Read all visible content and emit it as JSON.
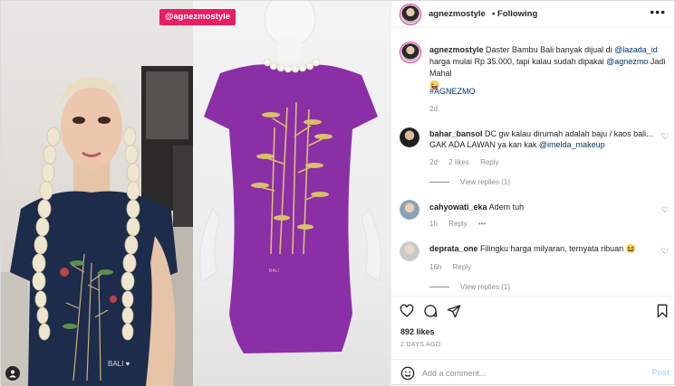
{
  "media": {
    "handle_tag": "@agnezmostyle"
  },
  "header": {
    "username": "agnezmostyle",
    "follow_status": "• Following",
    "more_icon": "more-horizontal-icon"
  },
  "caption": {
    "username": "agnezmostyle",
    "text_1": "Daster Bambu Bali banyak dijual di",
    "mention_1": "@lazada_id",
    "text_2": "harga mulai Rp 35.000, tapi kalau sudah dipakai",
    "mention_2": "@agnezmo",
    "text_3": "Jadi Mahal",
    "emoji": "😜",
    "hashtag": "#AGNEZMO",
    "time": "2d"
  },
  "comments": [
    {
      "username": "bahar_bansol",
      "text": "DC gw kalau dirumah adalah baju / kaos bali... GAK ADA LAWAN ya kan kak",
      "mention": "@imelda_makeup",
      "time": "2d",
      "likes": "2 likes",
      "reply": "Reply",
      "view_replies": "View replies (1)"
    },
    {
      "username": "cahyowati_eka",
      "text": "Adem tuh",
      "time": "1h",
      "reply": "Reply",
      "more": "•••"
    },
    {
      "username": "deprata_one",
      "text": "Filingku harga milyaran, ternyata ribuan",
      "emoji": "😆",
      "time": "16h",
      "reply": "Reply",
      "view_replies": "View replies (1)"
    }
  ],
  "stats": {
    "likes": "892 likes",
    "posted_ago": "2 DAYS AGO"
  },
  "add_comment": {
    "placeholder": "Add a comment...",
    "post_label": "Post"
  },
  "colors": {
    "accent_pink": "#e91e63",
    "link": "#00376b",
    "muted": "#8e8e8e",
    "post_disabled": "#b2dffc",
    "dress_purple": "#8b2fa7"
  }
}
